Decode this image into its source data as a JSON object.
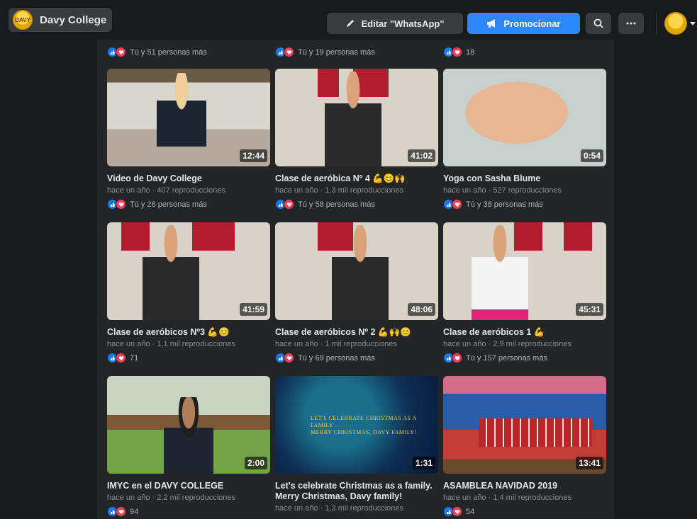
{
  "header": {
    "page_name": "Davy College",
    "edit_label": "Editar \"WhatsApp\"",
    "promote_label": "Promocionar",
    "logo_text": "DAVY"
  },
  "top_reactions": [
    {
      "text": "Tú y 51 personas más"
    },
    {
      "text": "Tú y 19 personas más"
    },
    {
      "text": "18"
    }
  ],
  "videos": [
    {
      "title": "Video de Davy College",
      "meta": "hace un año · 407 reproducciones",
      "duration": "12:44",
      "reactions": "Tú y 26 personas más"
    },
    {
      "title": "Clase de aeróbica Nº 4 💪😊🙌",
      "meta": "hace un año · 1,3 mil reproducciones",
      "duration": "41:02",
      "reactions": "Tú y 58 personas más"
    },
    {
      "title": "Yoga con Sasha Blume",
      "meta": "hace un año · 527 reproducciones",
      "duration": "0:54",
      "reactions": "Tú y 38 personas más"
    },
    {
      "title": "Clase de aeróbicos Nº3 💪😊",
      "meta": "hace un año · 1,1 mil reproducciones",
      "duration": "41:59",
      "reactions": "71"
    },
    {
      "title": "Clase de aeróbicos Nº 2 💪🙌😊",
      "meta": "hace un año · 1 mil reproducciones",
      "duration": "48:06",
      "reactions": "Tú y 69 personas más"
    },
    {
      "title": "Clase de aeróbicos 1 💪",
      "meta": "hace un año · 2,9 mil reproducciones",
      "duration": "45:31",
      "reactions": "Tú y 157 personas más"
    },
    {
      "title": "IMYC en el DAVY COLLEGE",
      "meta": "hace un año · 2,2 mil reproducciones",
      "duration": "2:00",
      "reactions": "94"
    },
    {
      "title": "Let's celebrate Christmas as a family. Merry Christmas, Davy family!",
      "meta": "hace un año · 1,3 mil reproducciones",
      "duration": "1:31",
      "reactions": ""
    },
    {
      "title": "ASAMBLEA NAVIDAD 2019",
      "meta": "hace un año · 1,4 mil reproducciones",
      "duration": "13:41",
      "reactions": "54"
    }
  ],
  "thumb_texts": {
    "xmas_line1": "LET'S CELEBRATE CHRISTMAS AS A FAMILY",
    "xmas_line2": "MERRY CHRISTMAS, DAVY FAMILY!"
  },
  "colors": {
    "background": "#18191a",
    "panel": "#242526",
    "promote": "#2d88ff",
    "like": "#1877f2",
    "love": "#f33e58"
  },
  "icons": {
    "edit": "pencil-icon",
    "promote": "megaphone-icon",
    "search": "search-icon",
    "more": "more-icon"
  }
}
